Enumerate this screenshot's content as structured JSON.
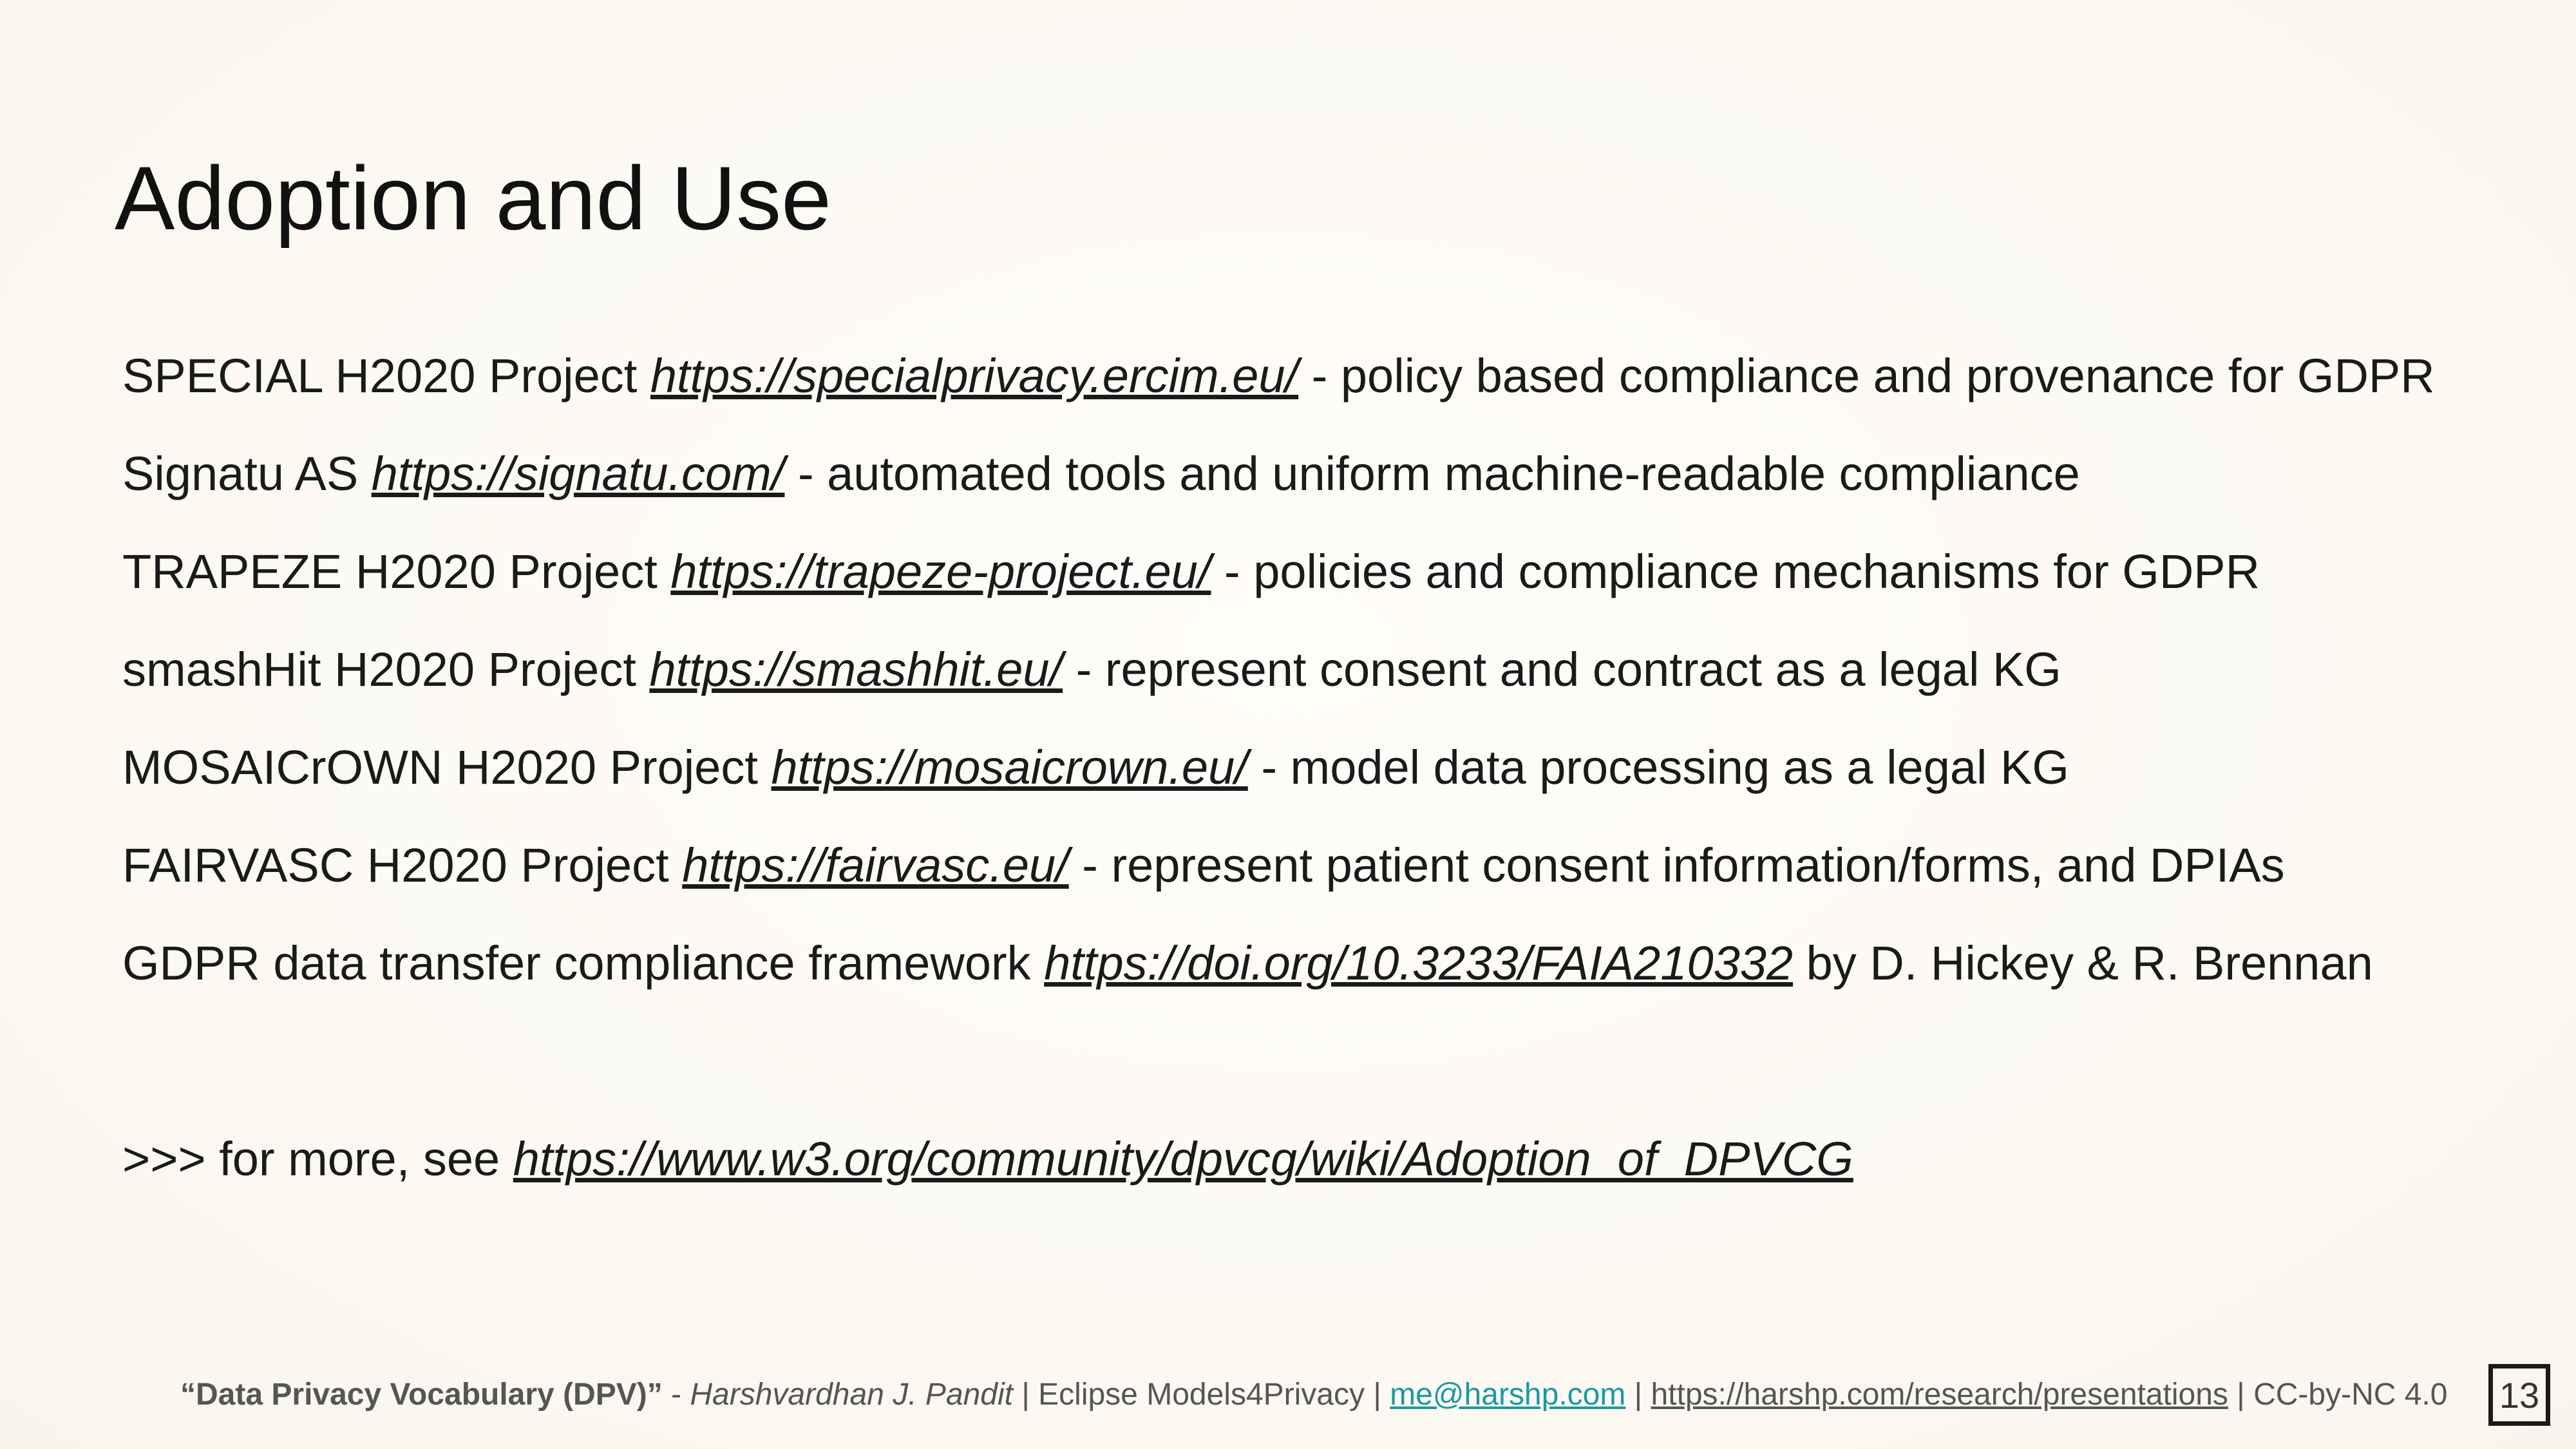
{
  "slide": {
    "title": "Adoption and Use",
    "items": [
      {
        "prefix": "SPECIAL H2020 Project ",
        "link": "https://specialprivacy.ercim.eu/",
        "suffix": " - policy based compliance and provenance for GDPR"
      },
      {
        "prefix": "Signatu AS ",
        "link": "https://signatu.com/",
        "suffix": "  - automated tools and uniform machine-readable compliance"
      },
      {
        "prefix": "TRAPEZE H2020 Project ",
        "link": "https://trapeze-project.eu/",
        "suffix": "  - policies and compliance mechanisms for GDPR"
      },
      {
        "prefix": "smashHit H2020 Project ",
        "link": "https://smashhit.eu/",
        "suffix": " - represent consent and contract as a legal KG"
      },
      {
        "prefix": "MOSAICrOWN H2020 Project ",
        "link": "https://mosaicrown.eu/",
        "suffix": " - model data processing as a legal KG"
      },
      {
        "prefix": "FAIRVASC H2020 Project ",
        "link": "https://fairvasc.eu/",
        "suffix": " - represent patient consent information/forms, and DPIAs"
      },
      {
        "prefix": "GDPR data transfer compliance framework ",
        "link": "https://doi.org/10.3233/FAIA210332",
        "suffix": " by D. Hickey & R. Brennan"
      }
    ],
    "more": {
      "prefix": ">>> for more, see ",
      "link": "https://www.w3.org/community/dpvcg/wiki/Adoption_of_DPVCG"
    }
  },
  "footer": {
    "title": "“Data Privacy Vocabulary (DPV)”",
    "sep1": " - ",
    "author": "Harshvardhan J. Pandit",
    "sep2": " | Eclipse Models4Privacy | ",
    "email": "me@harshp.com",
    "sep3": " | ",
    "url": "https://harshp.com/research/presentations",
    "sep4": " | CC-by-NC 4.0"
  },
  "page_number": "13",
  "colors": {
    "background": "#fcf9f3",
    "link_teal": "#1b9aa0",
    "text": "#1a1a1a"
  }
}
